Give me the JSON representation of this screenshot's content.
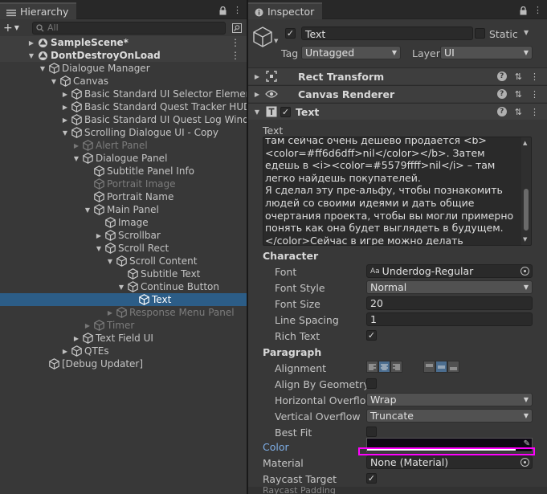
{
  "hierarchy": {
    "tab_label": "Hierarchy",
    "add_label": "+",
    "search_placeholder": "All",
    "rows": [
      {
        "label": "SampleScene*",
        "depth": 0,
        "arrow": "right",
        "icon": "unity-scene",
        "style": "scene",
        "kebab": true
      },
      {
        "label": "DontDestroyOnLoad",
        "depth": 0,
        "arrow": "down",
        "icon": "unity-scene",
        "style": "scene",
        "kebab": true
      },
      {
        "label": "Dialogue Manager",
        "depth": 1,
        "arrow": "down",
        "icon": "cube"
      },
      {
        "label": "Canvas",
        "depth": 2,
        "arrow": "down",
        "icon": "cube"
      },
      {
        "label": "Basic Standard UI Selector Element",
        "depth": 3,
        "arrow": "right",
        "icon": "cube"
      },
      {
        "label": "Basic Standard Quest Tracker HUD",
        "depth": 3,
        "arrow": "right",
        "icon": "cube"
      },
      {
        "label": "Basic Standard UI Quest Log Windo",
        "depth": 3,
        "arrow": "right",
        "icon": "cube"
      },
      {
        "label": "Scrolling Dialogue UI - Copy",
        "depth": 3,
        "arrow": "down",
        "icon": "cube"
      },
      {
        "label": "Alert Panel",
        "depth": 4,
        "arrow": "right",
        "icon": "cube",
        "style": "dim"
      },
      {
        "label": "Dialogue Panel",
        "depth": 4,
        "arrow": "down",
        "icon": "cube"
      },
      {
        "label": "Subtitle Panel Info",
        "depth": 5,
        "arrow": "",
        "icon": "cube"
      },
      {
        "label": "Portrait Image",
        "depth": 5,
        "arrow": "",
        "icon": "cube",
        "style": "dim"
      },
      {
        "label": "Portrait Name",
        "depth": 5,
        "arrow": "",
        "icon": "cube"
      },
      {
        "label": "Main Panel",
        "depth": 5,
        "arrow": "down",
        "icon": "cube"
      },
      {
        "label": "Image",
        "depth": 6,
        "arrow": "",
        "icon": "cube"
      },
      {
        "label": "Scrollbar",
        "depth": 6,
        "arrow": "right",
        "icon": "cube"
      },
      {
        "label": "Scroll Rect",
        "depth": 6,
        "arrow": "down",
        "icon": "cube"
      },
      {
        "label": "Scroll Content",
        "depth": 7,
        "arrow": "down",
        "icon": "cube"
      },
      {
        "label": "Subtitle Text",
        "depth": 8,
        "arrow": "",
        "icon": "cube"
      },
      {
        "label": "Continue Button",
        "depth": 8,
        "arrow": "down",
        "icon": "cube"
      },
      {
        "label": "Text",
        "depth": 9,
        "arrow": "",
        "icon": "cube",
        "style": "sel"
      },
      {
        "label": "Response Menu Panel",
        "depth": 7,
        "arrow": "right",
        "icon": "cube",
        "style": "dim"
      },
      {
        "label": "Timer",
        "depth": 5,
        "arrow": "right",
        "icon": "cube",
        "style": "dim"
      },
      {
        "label": "Text Field UI",
        "depth": 4,
        "arrow": "right",
        "icon": "cube"
      },
      {
        "label": "QTEs",
        "depth": 3,
        "arrow": "right",
        "icon": "cube"
      },
      {
        "label": "[Debug Updater]",
        "depth": 1,
        "arrow": "",
        "icon": "cube"
      }
    ]
  },
  "inspector": {
    "tab_label": "Inspector",
    "object_name": "Text",
    "static_label": "Static",
    "tag_label": "Tag",
    "tag_value": "Untagged",
    "layer_label": "Layer",
    "layer_value": "UI",
    "components": [
      {
        "name": "Rect Transform",
        "icon": "rect-transform-icon"
      },
      {
        "name": "Canvas Renderer",
        "icon": "eye-icon"
      },
      {
        "name": "Text",
        "icon": "text-component-icon"
      }
    ],
    "text_label": "Text",
    "text_content": "там сейчас очень дешево продается <b><color=#ff6d6dff>nil</color></b>. Затем едешь в <i><color=#5579ffff>nil</i> – там легко найдешь покупателей.\nЯ сделал эту пре-альфу, чтобы познакомить людей со своими идеями и дать общие очертания проекта, чтобы вы могли примерно понять как она будет выглядеть в будущем.\n</color>Сейчас в игре можно делать следующее:",
    "character_label": "Character",
    "font_label": "Font",
    "font_value": "Underdog-Regular",
    "font_style_label": "Font Style",
    "font_style_value": "Normal",
    "font_size_label": "Font Size",
    "font_size_value": "20",
    "line_spacing_label": "Line Spacing",
    "line_spacing_value": "1",
    "rich_text_label": "Rich Text",
    "paragraph_label": "Paragraph",
    "alignment_label": "Alignment",
    "align_by_geometry_label": "Align By Geometry",
    "h_overflow_label": "Horizontal Overflow",
    "h_overflow_value": "Wrap",
    "v_overflow_label": "Vertical Overflow",
    "v_overflow_value": "Truncate",
    "best_fit_label": "Best Fit",
    "color_label": "Color",
    "material_label": "Material",
    "material_value": "None (Material)",
    "raycast_target_label": "Raycast Target",
    "raycast_padding_label": "Raycast Padding"
  },
  "colors": {
    "selection": "#2c5d87",
    "color_label_accent": "#7eaee6",
    "highlight_box": "#ff00ff",
    "color_swatch": "#0d0714"
  }
}
